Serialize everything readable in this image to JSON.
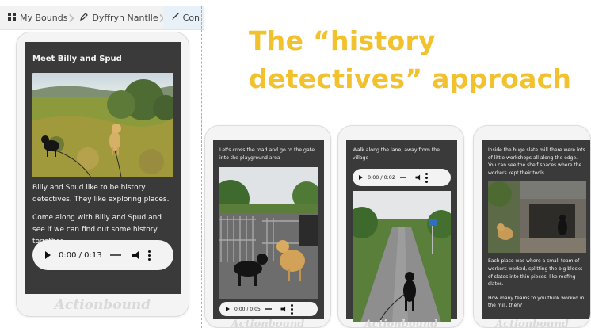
{
  "breadcrumb": {
    "items": [
      {
        "icon": "grid-icon",
        "label": "My Bounds"
      },
      {
        "icon": "pen-icon",
        "label": "Dyffryn Nantlle"
      },
      {
        "icon": "brush-icon",
        "label": "Con"
      }
    ]
  },
  "headline": {
    "line1": "The “history",
    "line2": "detectives” approach",
    "color": "#f2c12e"
  },
  "phone1": {
    "title": "Meet Billy and Spud",
    "text1": "Billy and Spud like to be history detectives. They like exploring places.",
    "text2": "Come along with Billy and Spud and see if we can find out some history together...",
    "audio_time": "0:00 / 0:13",
    "brand": "Actionbound"
  },
  "phone2": {
    "caption": "Let's cross the road and go to the gate into the playground area",
    "audio_time": "0:00 / 0:05",
    "brand": "Actionbound"
  },
  "phone3": {
    "caption": "Walk along the lane, away from the village",
    "audio_time": "0:00 / 0:02",
    "brand": "Actionbound"
  },
  "phone4": {
    "caption1": "Inside the huge slate mill there were lots of little workshops all along the edge. You can see the shelf spaces where the workers kept their tools.",
    "caption2": "Each place was where a small team of workers worked, splitting the big blocks of slates into thin pieces, like roofing slates.",
    "caption3": "How many teams to you think worked in the mill, then?",
    "brand": "Actionbound"
  }
}
